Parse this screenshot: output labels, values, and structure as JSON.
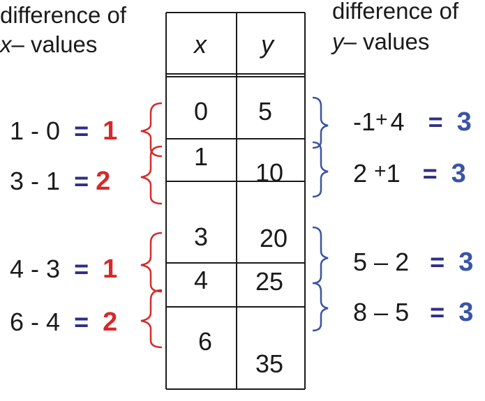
{
  "headers": {
    "left": {
      "line1": "difference of",
      "var": "x",
      "line2": "– values"
    },
    "right": {
      "line1": "difference of",
      "var": "y",
      "line2": "– values"
    }
  },
  "table": {
    "col_x": "x",
    "col_y": "y",
    "rows": [
      {
        "x": "0",
        "y": "5"
      },
      {
        "x": "1",
        "y": "10"
      },
      {
        "x": "3",
        "y": "20"
      },
      {
        "x": "4",
        "y": "25"
      },
      {
        "x": "6",
        "y": "35"
      }
    ]
  },
  "x_differences": [
    {
      "expr": "1 - 0",
      "eq": "=",
      "result": "1"
    },
    {
      "expr": "3 - 1",
      "eq": "=",
      "result": "2"
    },
    {
      "expr": "4 - 3",
      "eq": "=",
      "result": "1"
    },
    {
      "expr": "6 - 4",
      "eq": "=",
      "result": "2"
    }
  ],
  "y_differences": [
    {
      "a": "-1",
      "op": "+",
      "b": "4",
      "eq": "=",
      "result": "3"
    },
    {
      "a": "2",
      "op": "+",
      "b": "1",
      "eq": "=",
      "result": "3"
    },
    {
      "a": "5",
      "op": "–",
      "b": "2",
      "eq": "=",
      "result": "3"
    },
    {
      "a": "8",
      "op": "–",
      "b": "5",
      "eq": "=",
      "result": "3"
    }
  ],
  "colors": {
    "left_brace": "#d42a2a",
    "right_brace": "#3a54a4",
    "table_line": "#1a1a1a"
  }
}
